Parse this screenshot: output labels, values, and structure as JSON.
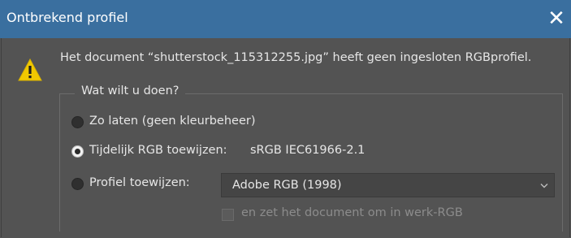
{
  "window": {
    "title": "Ontbrekend profiel",
    "close_icon": "close-icon"
  },
  "message": "Het document “shutterstock_115312255.jpg” heeft geen ingesloten RGBprofiel.",
  "group": {
    "legend": "Wat wilt u doen?",
    "options": [
      {
        "label": "Zo laten (geen kleurbeheer)",
        "checked": false
      },
      {
        "label": "Tijdelijk RGB toewijzen:",
        "checked": true,
        "value": "sRGB IEC61966-2.1"
      },
      {
        "label": "Profiel toewijzen:",
        "checked": false
      }
    ],
    "profile_select": {
      "selected": "Adobe RGB (1998)"
    },
    "convert_checkbox": {
      "label": "en zet het document om in werk-RGB",
      "checked": false,
      "enabled": false
    }
  },
  "colors": {
    "titlebar": "#3a6f9f",
    "background": "#535353",
    "warning": "#f0c800"
  }
}
